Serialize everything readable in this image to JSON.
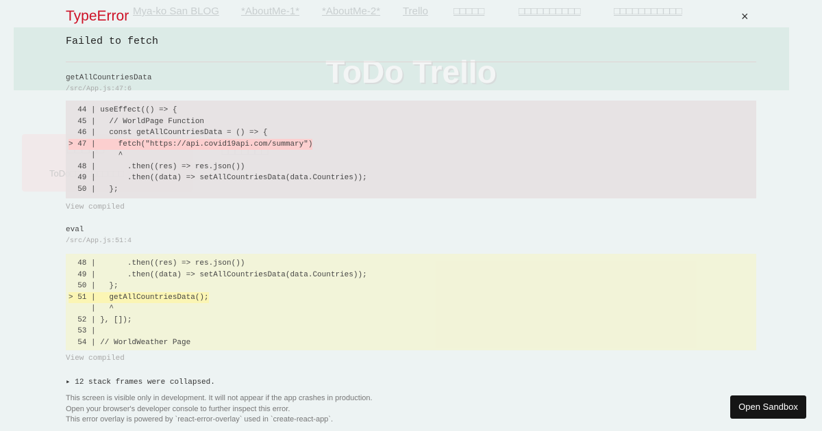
{
  "background": {
    "nav": [
      "Mya-ko San BLOG",
      "*AboutMe-1*",
      "*AboutMe-2*",
      "Trello",
      "□□□□□",
      "□□□□□□□□□□",
      "□□□□□□□□□□□"
    ],
    "title": "ToDo Trello",
    "card_title": "□□□□□",
    "card_sub": "ToDo□□□□□□□□□□",
    "pill": "□□□□□□□"
  },
  "overlay": {
    "error_type": "TypeError",
    "close": "×",
    "message": "Failed to fetch",
    "frames": [
      {
        "fn": "getAllCountriesData",
        "loc": "/src/App.js:47:6",
        "lines": [
          "  44 | useEffect(() => {",
          "  45 |   // WorldPage Function",
          "  46 |   const getAllCountriesData = () => {",
          "> 47 |     fetch(\"https://api.covid19api.com/summary\")",
          "     |     ^",
          "  48 |       .then((res) => res.json())",
          "  49 |       .then((data) => setAllCountriesData(data.Countries));",
          "  50 |   };"
        ],
        "view": "View compiled"
      },
      {
        "fn": "eval",
        "loc": "/src/App.js:51:4",
        "lines": [
          "  48 |       .then((res) => res.json())",
          "  49 |       .then((data) => setAllCountriesData(data.Countries));",
          "  50 |   };",
          "> 51 |   getAllCountriesData();",
          "     |   ^",
          "  52 | }, []);",
          "  53 |",
          "  54 | // WorldWeather Page"
        ],
        "view": "View compiled"
      }
    ],
    "collapsed": "▸ 12 stack frames were collapsed.",
    "footer": [
      "This screen is visible only in development. It will not appear if the app crashes in production.",
      "Open your browser's developer console to further inspect this error.",
      "This error overlay is powered by `react-error-overlay` used in `create-react-app`."
    ],
    "open_sandbox": "Open Sandbox",
    "colors": {
      "error": "#ce1126",
      "highlight1": "#fccfcf",
      "highlight2": "#fbf5b4"
    }
  }
}
